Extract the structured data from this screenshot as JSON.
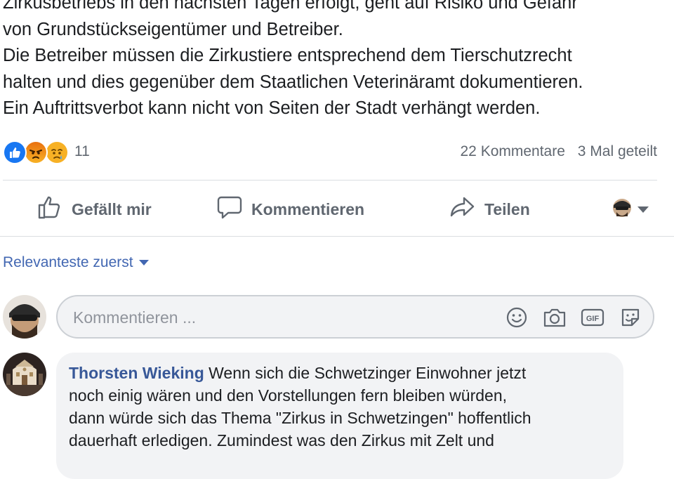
{
  "post": {
    "lines": [
      "Zirkusbetriebs in den nächsten Tagen erfolgt, geht auf Risiko und Gefahr",
      "von Grundstückseigentümer und Betreiber.",
      "Die Betreiber müssen die Zirkustiere entsprechend dem Tierschutzrecht",
      "halten und dies gegenüber dem Staatlichen Veterinäramt dokumentieren.",
      "Ein Auftrittsverbot kann nicht von Seiten der Stadt verhängt werden."
    ]
  },
  "reactions": {
    "icons": [
      "like-icon",
      "angry-icon",
      "sad-icon"
    ],
    "count": "11",
    "comments_label": "22 Kommentare",
    "shares_label": "3 Mal geteilt"
  },
  "actions": {
    "like_label": "Gefällt mir",
    "comment_label": "Kommentieren",
    "share_label": "Teilen"
  },
  "sort": {
    "label": "Relevanteste zuerst"
  },
  "composer": {
    "placeholder": "Kommentieren ...",
    "tools": [
      "emoji-icon",
      "camera-icon",
      "gif-icon",
      "sticker-icon"
    ]
  },
  "comment": {
    "author": "Thorsten Wieking",
    "first_line": "Wenn sich die Schwetzinger Einwohner jetzt",
    "lines": [
      "noch einig wären und den Vorstellungen fern bleiben würden,",
      "dann würde sich das Thema \"Zirkus in Schwetzingen\" hoffentlich",
      "dauerhaft erledigen. Zumindest was den Zirkus mit Zelt und"
    ]
  },
  "colors": {
    "link": "#385898",
    "accent": "#4267b2",
    "muted_text": "#606770",
    "like_blue": "#1877f2",
    "angry_red": "#e9710f",
    "sad_yellow": "#f7b125"
  }
}
